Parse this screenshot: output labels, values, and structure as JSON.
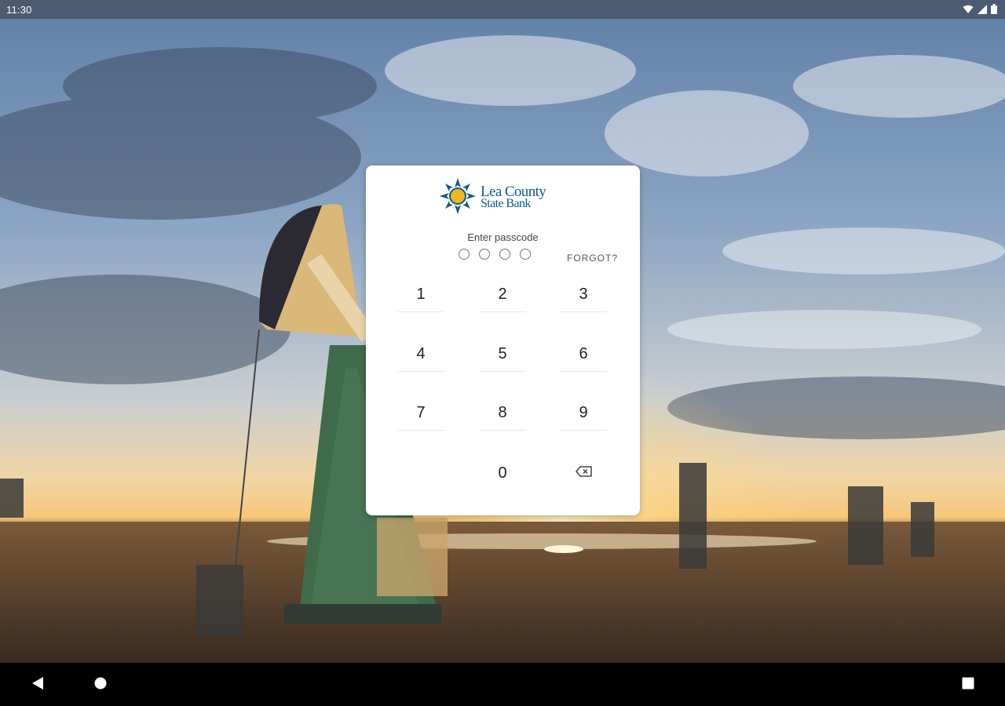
{
  "status_bar": {
    "time": "11:30",
    "wifi_icon": "wifi-icon",
    "signal_icon": "signal-icon",
    "battery_icon": "battery-icon"
  },
  "brand": {
    "name_line1": "Lea County",
    "name_line2": "State Bank",
    "logo_icon": "sun-star-logo",
    "color": "#0d5a8e",
    "accent": "#f1b61e"
  },
  "passcode": {
    "prompt": "Enter passcode",
    "digits_entered": 0,
    "length": 4,
    "forgot_label": "FORGOT?"
  },
  "keypad": {
    "keys": [
      "1",
      "2",
      "3",
      "4",
      "5",
      "6",
      "7",
      "8",
      "9",
      "0"
    ],
    "backspace_icon": "backspace-icon"
  },
  "nav_bar": {
    "back_icon": "back-triangle-icon",
    "home_icon": "home-circle-icon",
    "recents_icon": "recents-square-icon"
  }
}
